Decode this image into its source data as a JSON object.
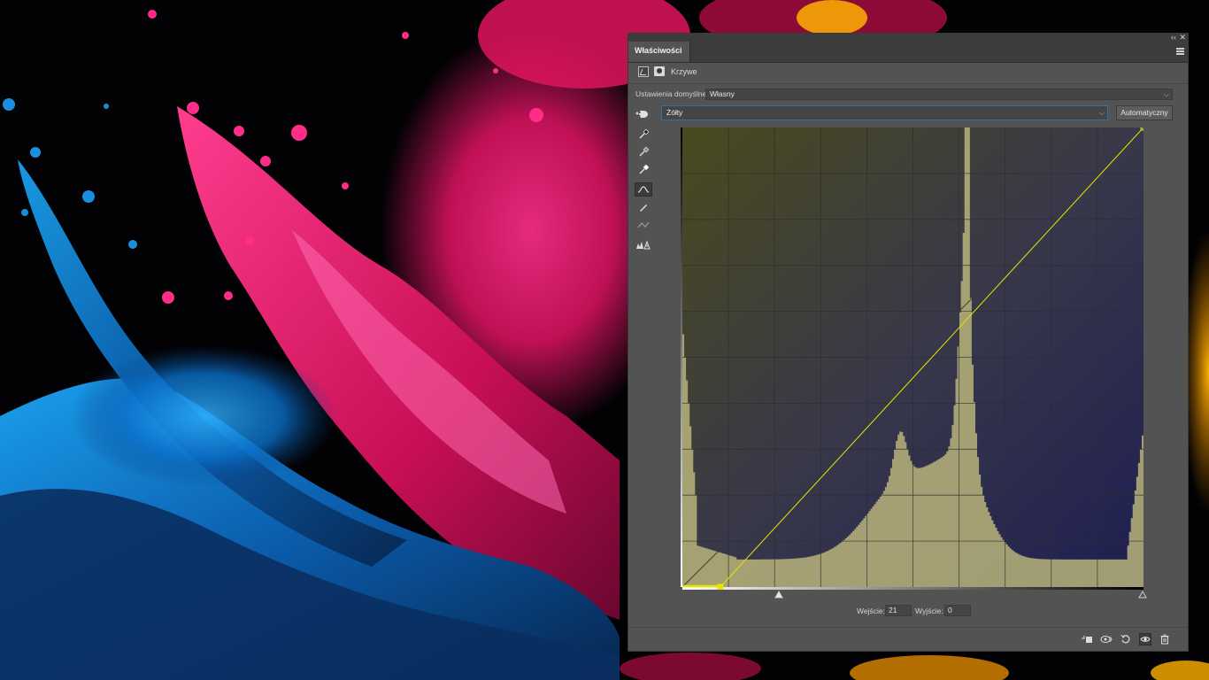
{
  "panel": {
    "tab_title": "Właściwości",
    "adjustment_name": "Krzywe",
    "collapse_glyph": "‹‹",
    "close_glyph": "✕"
  },
  "preset": {
    "label": "Ustawienia domyślne:",
    "value": "Własny"
  },
  "channel": {
    "value": "Żółty"
  },
  "auto_button": "Automatyczny",
  "curve": {
    "input_label": "Wejście:",
    "input_value": "21",
    "output_label": "Wyjście:",
    "output_value": "0",
    "points": [
      [
        21,
        0
      ],
      [
        255,
        255
      ]
    ],
    "curve_color": "#e6e600"
  },
  "tools": [
    "sample-in-image-to-set-black-point-icon",
    "sample-in-image-to-set-gray-point-icon",
    "sample-in-image-to-set-white-point-icon",
    "edit-points-icon",
    "draw-curve-icon",
    "smooth-curve-icon",
    "clipping-warning-icon"
  ],
  "footer_icons": [
    "clip-to-layer-icon",
    "view-previous-state-icon",
    "reset-icon",
    "visibility-eye-icon",
    "delete-icon"
  ],
  "colors": {
    "panel_bg": "#535353",
    "histogram": "#b8b47a",
    "accent_focus": "#2f6fb0"
  }
}
